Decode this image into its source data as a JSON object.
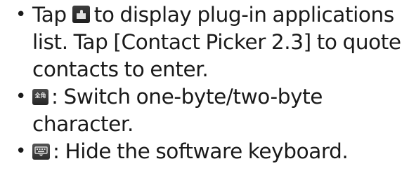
{
  "items": [
    {
      "bullet": "•",
      "before": "Tap",
      "icon": "plugin-icon",
      "text": "to display plug-in applications list. Tap [Contact Picker 2.3] to quote contacts to enter."
    },
    {
      "bullet": "•",
      "icon": "one-two-byte-switch-icon",
      "icon_label": "全角",
      "text": ": Switch one-byte/two-byte character."
    },
    {
      "bullet": "•",
      "icon": "hide-keyboard-icon",
      "text": ": Hide the software keyboard."
    }
  ]
}
